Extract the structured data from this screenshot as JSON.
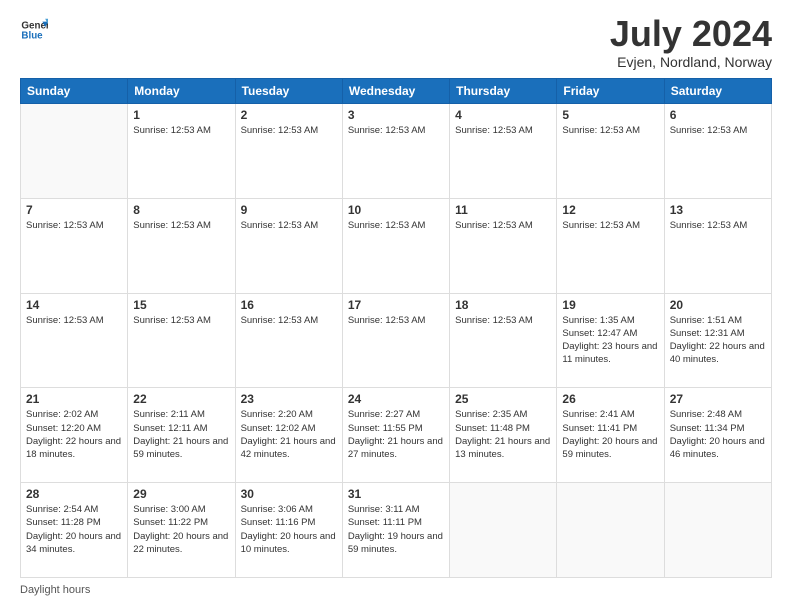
{
  "logo": {
    "line1": "General",
    "line2": "Blue"
  },
  "title": "July 2024",
  "location": "Evjen, Nordland, Norway",
  "weekdays": [
    "Sunday",
    "Monday",
    "Tuesday",
    "Wednesday",
    "Thursday",
    "Friday",
    "Saturday"
  ],
  "weeks": [
    [
      {
        "day": "",
        "info": ""
      },
      {
        "day": "1",
        "info": "Sunrise: 12:53 AM"
      },
      {
        "day": "2",
        "info": "Sunrise: 12:53 AM"
      },
      {
        "day": "3",
        "info": "Sunrise: 12:53 AM"
      },
      {
        "day": "4",
        "info": "Sunrise: 12:53 AM"
      },
      {
        "day": "5",
        "info": "Sunrise: 12:53 AM"
      },
      {
        "day": "6",
        "info": "Sunrise: 12:53 AM"
      }
    ],
    [
      {
        "day": "7",
        "info": "Sunrise: 12:53 AM"
      },
      {
        "day": "8",
        "info": "Sunrise: 12:53 AM"
      },
      {
        "day": "9",
        "info": "Sunrise: 12:53 AM"
      },
      {
        "day": "10",
        "info": "Sunrise: 12:53 AM"
      },
      {
        "day": "11",
        "info": "Sunrise: 12:53 AM"
      },
      {
        "day": "12",
        "info": "Sunrise: 12:53 AM"
      },
      {
        "day": "13",
        "info": "Sunrise: 12:53 AM"
      }
    ],
    [
      {
        "day": "14",
        "info": "Sunrise: 12:53 AM"
      },
      {
        "day": "15",
        "info": "Sunrise: 12:53 AM"
      },
      {
        "day": "16",
        "info": "Sunrise: 12:53 AM"
      },
      {
        "day": "17",
        "info": "Sunrise: 12:53 AM"
      },
      {
        "day": "18",
        "info": "Sunrise: 12:53 AM"
      },
      {
        "day": "19",
        "info": "Sunrise: 1:35 AM\nSunset: 12:47 AM\nDaylight: 23 hours and 11 minutes."
      },
      {
        "day": "20",
        "info": "Sunrise: 1:51 AM\nSunset: 12:31 AM\nDaylight: 22 hours and 40 minutes."
      }
    ],
    [
      {
        "day": "21",
        "info": "Sunrise: 2:02 AM\nSunset: 12:20 AM\nDaylight: 22 hours and 18 minutes."
      },
      {
        "day": "22",
        "info": "Sunrise: 2:11 AM\nSunset: 12:11 AM\nDaylight: 21 hours and 59 minutes."
      },
      {
        "day": "23",
        "info": "Sunrise: 2:20 AM\nSunset: 12:02 AM\nDaylight: 21 hours and 42 minutes."
      },
      {
        "day": "24",
        "info": "Sunrise: 2:27 AM\nSunset: 11:55 PM\nDaylight: 21 hours and 27 minutes."
      },
      {
        "day": "25",
        "info": "Sunrise: 2:35 AM\nSunset: 11:48 PM\nDaylight: 21 hours and 13 minutes."
      },
      {
        "day": "26",
        "info": "Sunrise: 2:41 AM\nSunset: 11:41 PM\nDaylight: 20 hours and 59 minutes."
      },
      {
        "day": "27",
        "info": "Sunrise: 2:48 AM\nSunset: 11:34 PM\nDaylight: 20 hours and 46 minutes."
      }
    ],
    [
      {
        "day": "28",
        "info": "Sunrise: 2:54 AM\nSunset: 11:28 PM\nDaylight: 20 hours and 34 minutes."
      },
      {
        "day": "29",
        "info": "Sunrise: 3:00 AM\nSunset: 11:22 PM\nDaylight: 20 hours and 22 minutes."
      },
      {
        "day": "30",
        "info": "Sunrise: 3:06 AM\nSunset: 11:16 PM\nDaylight: 20 hours and 10 minutes."
      },
      {
        "day": "31",
        "info": "Sunrise: 3:11 AM\nSunset: 11:11 PM\nDaylight: 19 hours and 59 minutes."
      },
      {
        "day": "",
        "info": ""
      },
      {
        "day": "",
        "info": ""
      },
      {
        "day": "",
        "info": ""
      }
    ]
  ],
  "footer": "Daylight hours"
}
